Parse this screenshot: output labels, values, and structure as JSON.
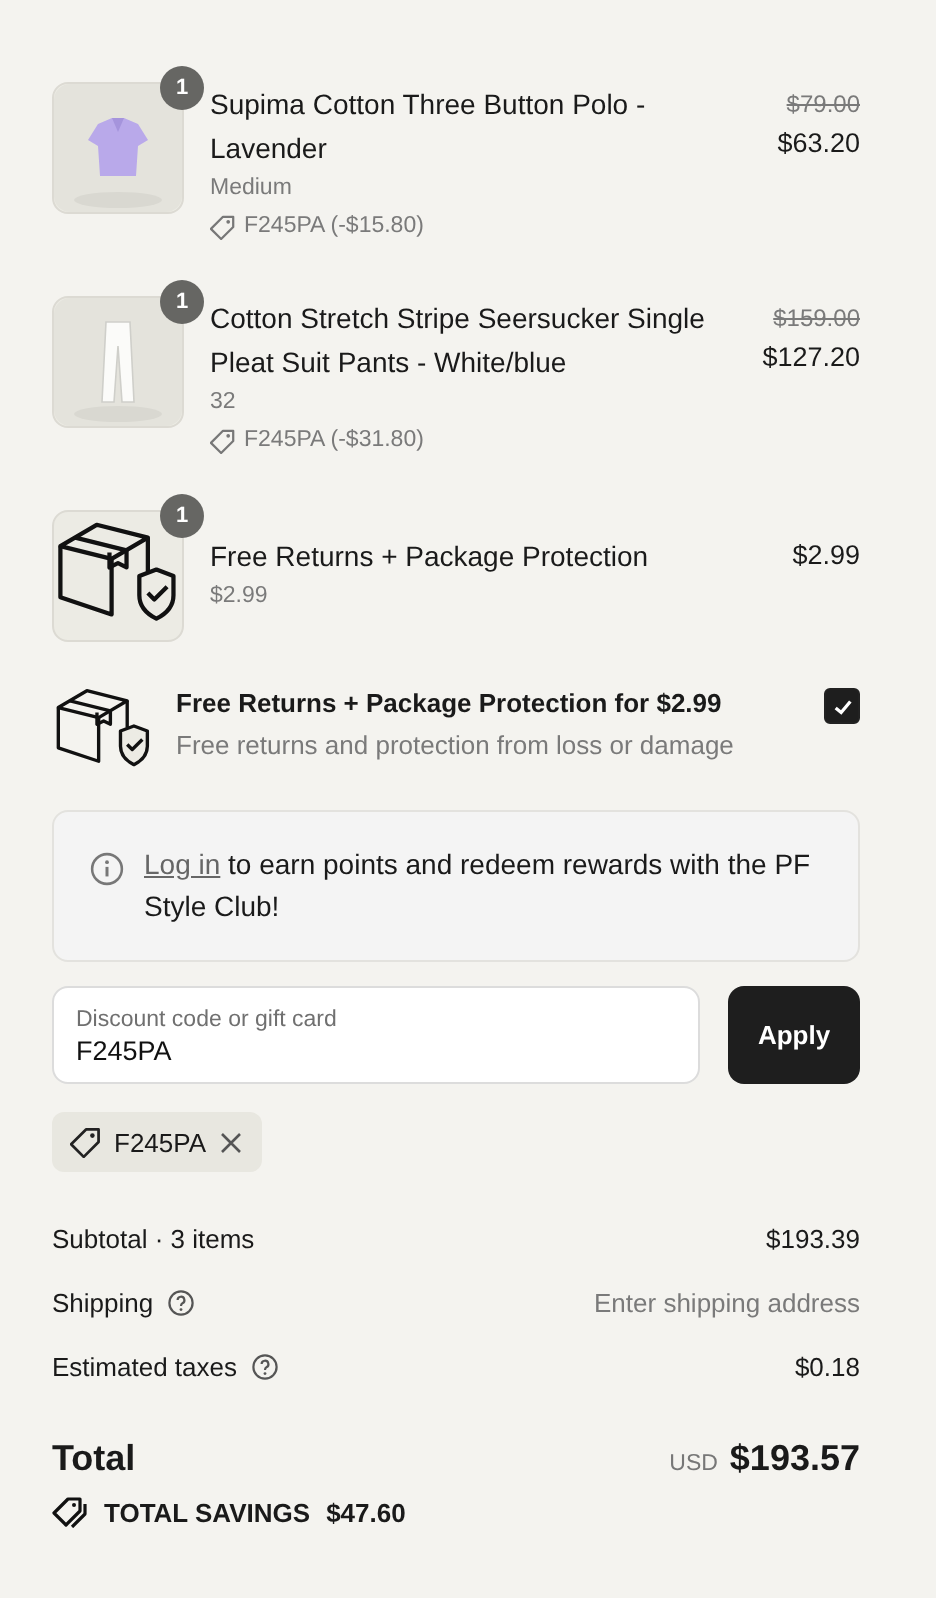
{
  "line_items": [
    {
      "kind": "product",
      "quantity": "1",
      "title": "Supima Cotton Three Button Polo - Lavender",
      "variant": "Medium",
      "discount": "F245PA (-$15.80)",
      "compare_price": "$79.00",
      "price": "$63.20"
    },
    {
      "kind": "product",
      "quantity": "1",
      "title": "Cotton Stretch Stripe Seersucker Single Pleat Suit Pants - White/blue",
      "variant": "32",
      "discount": "F245PA (-$31.80)",
      "compare_price": "$159.00",
      "price": "$127.20"
    },
    {
      "kind": "protection",
      "quantity": "1",
      "title": "Free Returns + Package Protection",
      "variant": "$2.99",
      "price": "$2.99"
    }
  ],
  "protection_offer": {
    "title": "Free Returns + Package Protection for $2.99",
    "subtitle": "Free returns and protection from loss or damage",
    "checked": true
  },
  "rewards_notice": {
    "link": "Log in",
    "text": "to earn points and redeem rewards with the PF Style Club!"
  },
  "discount_field": {
    "label": "Discount code or gift card",
    "value": "F245PA",
    "button": "Apply"
  },
  "applied_codes": [
    {
      "code": "F245PA"
    }
  ],
  "summary": [
    {
      "label": "Subtotal · 3 items",
      "help": false,
      "kind": "amount",
      "value": "$193.39"
    },
    {
      "label": "Shipping",
      "help": true,
      "kind": "hint",
      "value": "Enter shipping address"
    },
    {
      "label": "Estimated taxes",
      "help": true,
      "kind": "amount",
      "value": "$0.18"
    }
  ],
  "total": {
    "label": "Total",
    "currency": "USD",
    "amount": "$193.57"
  },
  "savings": {
    "label": "TOTAL SAVINGS",
    "amount": "$47.60"
  }
}
